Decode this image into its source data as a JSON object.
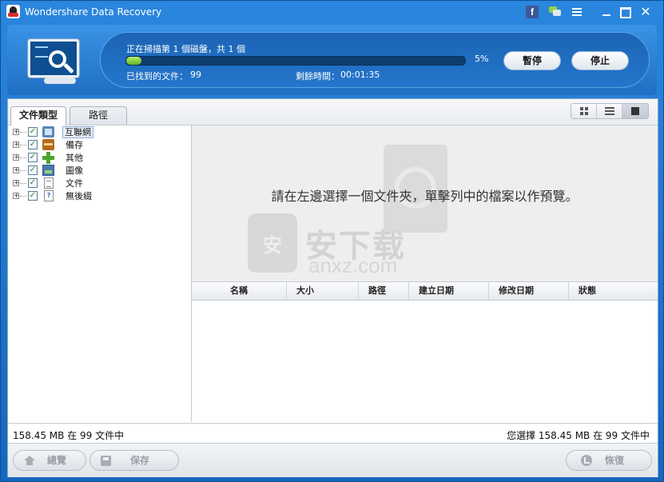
{
  "window": {
    "title": "Wondershare Data Recovery",
    "icons": [
      "app-icon",
      "facebook-icon",
      "chat-icon",
      "menu-icon",
      "minimize-icon",
      "maximize-icon",
      "close-icon"
    ],
    "facebook_glyph": "f"
  },
  "scan": {
    "status": "正在掃描第 1 個磁盤，共 1 個",
    "progress_percent": 5,
    "progress_label": "5%",
    "found_label": "已找到的文件：",
    "found_count": "99",
    "remaining_label": "剩餘時間：",
    "remaining_time": "00:01:35",
    "pause_label": "暫停",
    "stop_label": "停止",
    "accent_color": "#1f6fc4",
    "progress_color": "#5fb52a"
  },
  "tabs": [
    {
      "label": "文件類型",
      "active": true
    },
    {
      "label": "路徑",
      "active": false
    }
  ],
  "view_modes": [
    "grid-view",
    "list-view",
    "detail-view"
  ],
  "active_view": "detail-view",
  "tree": [
    {
      "label": "互聯網",
      "icon": "internet-icon",
      "checked": true,
      "selected": true
    },
    {
      "label": "備存",
      "icon": "archive-icon",
      "checked": true,
      "selected": false
    },
    {
      "label": "其他",
      "icon": "puzzle-icon",
      "checked": true,
      "selected": false
    },
    {
      "label": "圖像",
      "icon": "image-icon",
      "checked": true,
      "selected": false
    },
    {
      "label": "文件",
      "icon": "document-icon",
      "checked": true,
      "selected": false
    },
    {
      "label": "無後綴",
      "icon": "unknown-file-icon",
      "checked": true,
      "selected": false
    }
  ],
  "tree_unknown_glyph": "?",
  "preview": {
    "message": "請在左邊選擇一個文件夾，單擊列中的檔案以作預覽。",
    "watermark_text": "安下载",
    "watermark_sub": "anxz.com"
  },
  "table": {
    "columns": [
      "名稱",
      "大小",
      "路徑",
      "建立日期",
      "修改日期",
      "狀態"
    ],
    "rows": []
  },
  "status": {
    "left": "158.45 MB 在 99 文件中",
    "right": "您選擇 158.45 MB 在 99 文件中"
  },
  "toolbar": {
    "preview_label": "總覽",
    "save_label": "保存",
    "recover_label": "恢復"
  }
}
